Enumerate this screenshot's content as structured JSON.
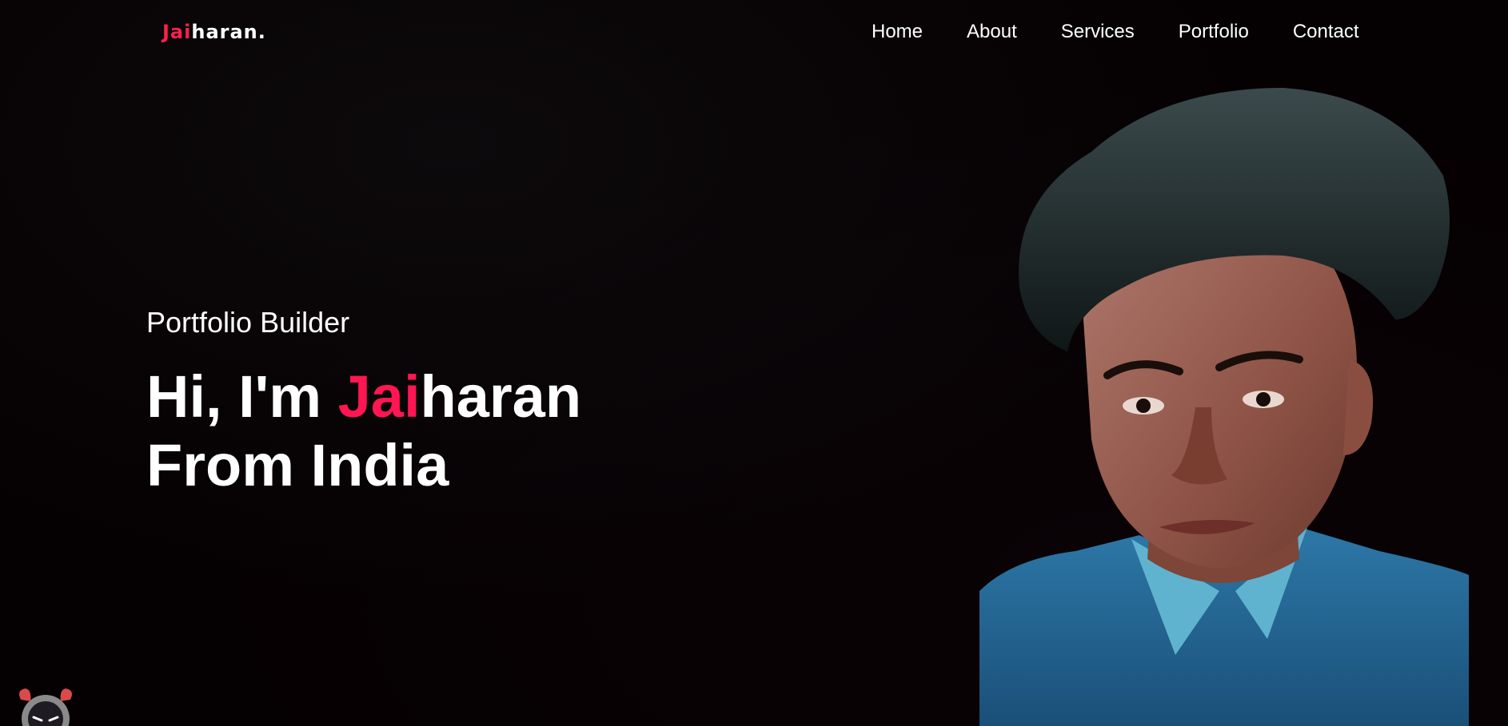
{
  "header": {
    "logo_accent": "Jai",
    "logo_rest": "haran.",
    "nav": [
      {
        "label": "Home"
      },
      {
        "label": "About"
      },
      {
        "label": "Services"
      },
      {
        "label": "Portfolio"
      },
      {
        "label": "Contact"
      }
    ]
  },
  "hero": {
    "subtitle": "Portfolio Builder",
    "line1_prefix": "Hi, I'm ",
    "line1_accent": "Jai",
    "line1_rest": "haran",
    "line2": "From India"
  },
  "colors": {
    "accent": "#ff1652",
    "background": "#050002",
    "text": "#ffffff"
  },
  "icons": {
    "mascot": "robot-mascot-icon"
  }
}
